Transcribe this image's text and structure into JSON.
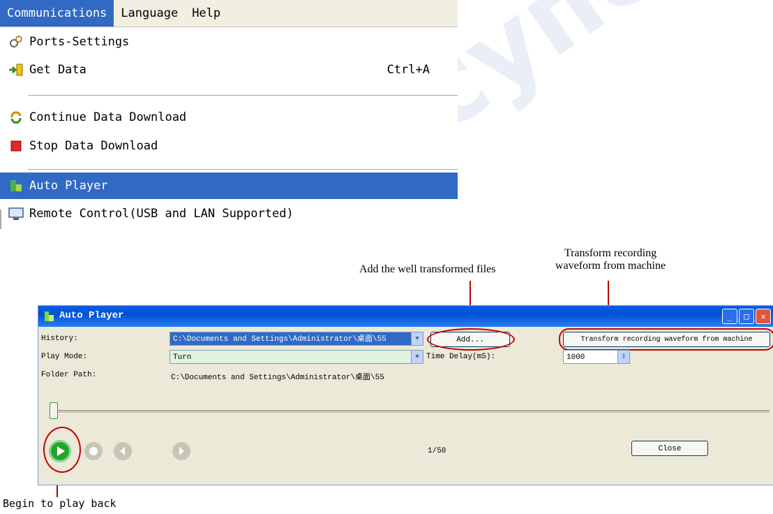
{
  "menu": {
    "items": [
      "Communications",
      "Language",
      "Help"
    ],
    "dropdown": {
      "ports_settings": "Ports-Settings",
      "get_data": "Get Data",
      "get_data_shortcut": "Ctrl+A",
      "continue_download": "Continue Data Download",
      "stop_download": "Stop Data Download",
      "auto_player": "Auto Player",
      "remote_control": "Remote Control(USB and LAN Supported)"
    }
  },
  "annotations": {
    "add_files": "Add the well transformed files",
    "transform_line1": "Transform recording",
    "transform_line2": "waveform from machine",
    "begin_play": "Begin to play back"
  },
  "dialog": {
    "title": "Auto Player",
    "history_label": "History:",
    "history_value": "C:\\Documents and Settings\\Administrator\\桌面\\55",
    "add_button": "Add...",
    "transform_button": "Transform recording waveform from machine",
    "play_mode_label": "Play Mode:",
    "play_mode_value": "Turn",
    "time_delay_label": "Time Delay(mS):",
    "time_delay_value": "1000",
    "folder_path_label": "Folder Path:",
    "folder_path_value": "C:\\Documents and Settings\\Administrator\\桌面\\55",
    "counter": "1/50",
    "close_button": "Close"
  },
  "colors": {
    "highlight": "#316ac5",
    "annotation_red": "#c40000",
    "play_green": "#22a52c"
  }
}
